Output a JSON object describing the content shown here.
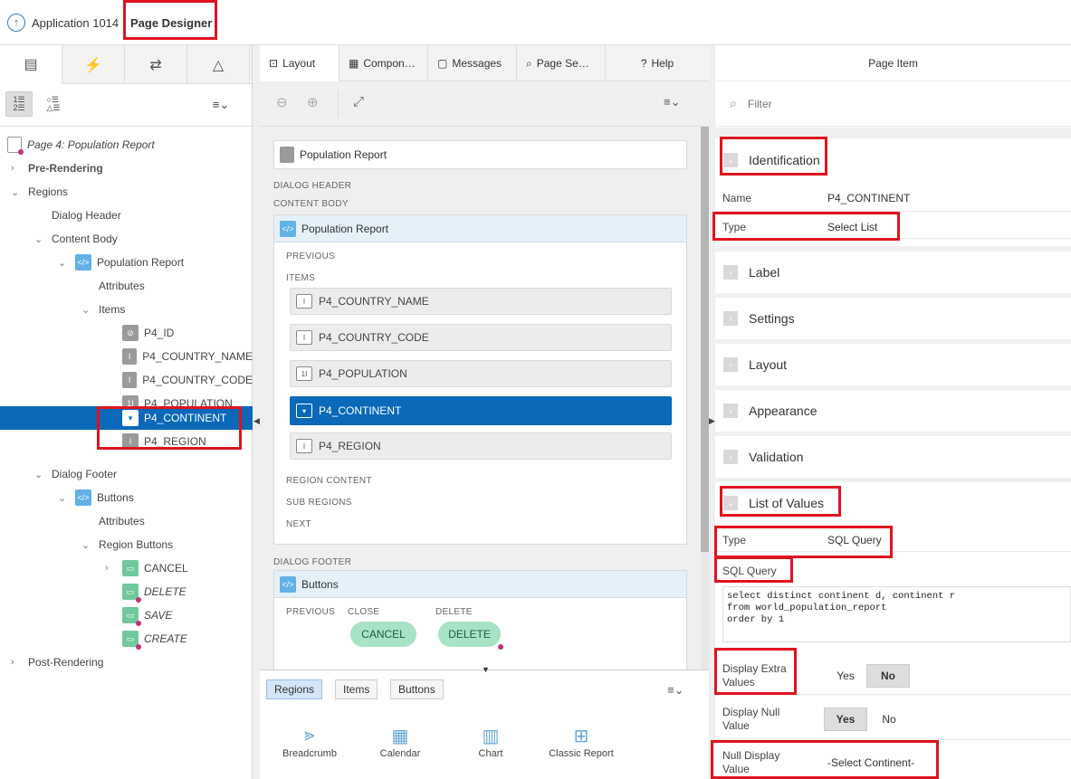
{
  "header": {
    "app_name": "Application 1014",
    "page_designer": "Page Designer"
  },
  "left": {
    "tree": [
      {
        "label": "Page 4: Population Report",
        "italic": true
      },
      {
        "label": "Pre-Rendering"
      },
      {
        "label": "Regions"
      },
      {
        "label": "Dialog Header"
      },
      {
        "label": "Content Body"
      },
      {
        "label": "Population Report"
      },
      {
        "label": "Attributes"
      },
      {
        "label": "Items"
      },
      {
        "label": "P4_ID"
      },
      {
        "label": "P4_COUNTRY_NAME"
      },
      {
        "label": "P4_COUNTRY_CODE"
      },
      {
        "label": "P4_POPULATION"
      },
      {
        "label": "P4_CONTINENT"
      },
      {
        "label": "P4_REGION"
      },
      {
        "label": "Dialog Footer"
      },
      {
        "label": "Buttons"
      },
      {
        "label": "Attributes"
      },
      {
        "label": "Region Buttons"
      },
      {
        "label": "CANCEL"
      },
      {
        "label": "DELETE"
      },
      {
        "label": "SAVE"
      },
      {
        "label": "CREATE"
      },
      {
        "label": "Post-Rendering"
      }
    ]
  },
  "center": {
    "tabs": [
      "Layout",
      "Compon…",
      "Messages",
      "Page Se…",
      "Help"
    ],
    "page_box": "Population Report",
    "dialog_header": "DIALOG HEADER",
    "content_body": "CONTENT BODY",
    "region_title": "Population Report",
    "previous": "PREVIOUS",
    "items_label": "ITEMS",
    "items": [
      "P4_COUNTRY_NAME",
      "P4_COUNTRY_CODE",
      "P4_POPULATION",
      "P4_CONTINENT",
      "P4_REGION"
    ],
    "region_content": "REGION CONTENT",
    "sub_regions": "SUB REGIONS",
    "next": "NEXT",
    "dialog_footer": "DIALOG FOOTER",
    "buttons_title": "Buttons",
    "btn_previous": "PREVIOUS",
    "btn_close": "CLOSE",
    "btn_delete_lbl": "DELETE",
    "cancel_pill": "CANCEL",
    "delete_pill": "DELETE",
    "gallery_tabs": [
      "Regions",
      "Items",
      "Buttons"
    ],
    "gallery_items": [
      "Breadcrumb",
      "Calendar",
      "Chart",
      "Classic Report"
    ]
  },
  "right": {
    "title": "Page Item",
    "filter_placeholder": "Filter",
    "identification": "Identification",
    "name_label": "Name",
    "name_value": "P4_CONTINENT",
    "type_label": "Type",
    "type_value": "Select List",
    "label": "Label",
    "settings": "Settings",
    "layout": "Layout",
    "appearance": "Appearance",
    "validation": "Validation",
    "lov": "List of Values",
    "lov_type_label": "Type",
    "lov_type_value": "SQL Query",
    "sql_label": "SQL Query",
    "sql": "select distinct continent d, continent r\nfrom world_population_report\norder by 1",
    "extra_label": "Display Extra Values",
    "extra_yes": "Yes",
    "extra_no": "No",
    "null_label": "Display Null Value",
    "null_yes": "Yes",
    "null_no": "No",
    "null_disp_label": "Null Display Value",
    "null_disp_value": "-Select Continent-"
  }
}
